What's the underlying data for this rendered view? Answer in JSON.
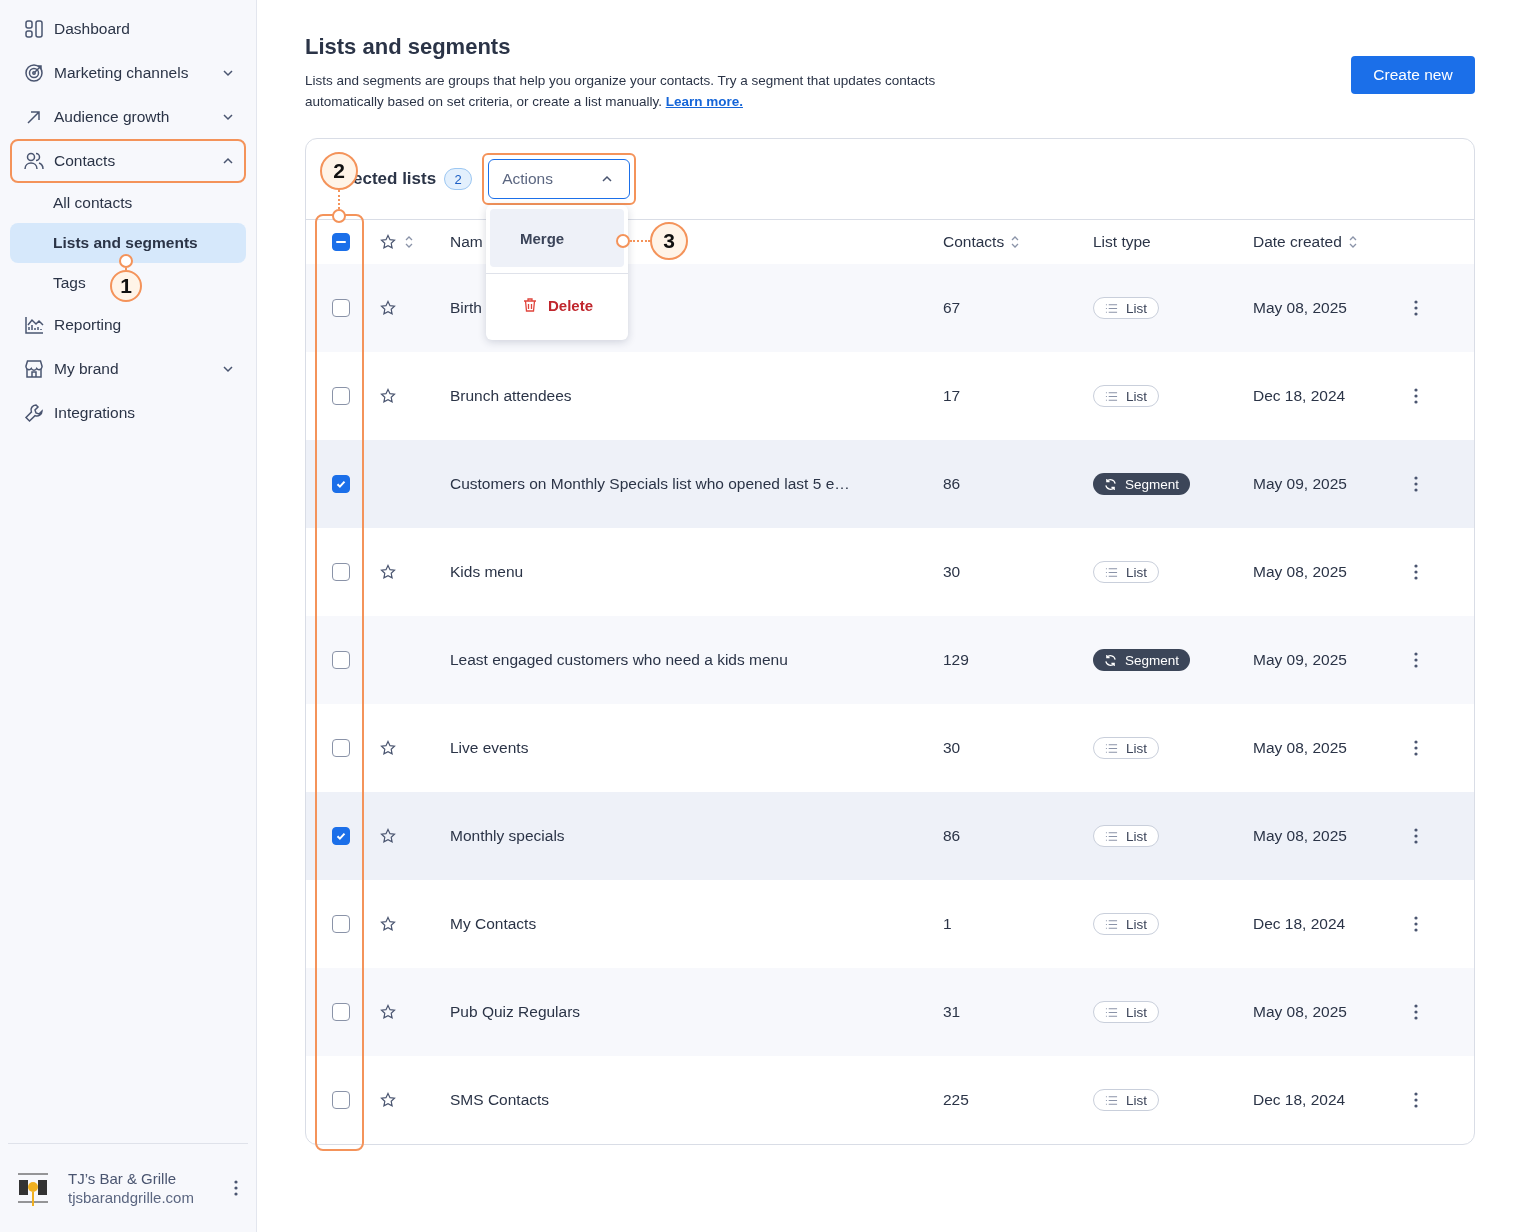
{
  "sidebar": {
    "items": [
      {
        "label": "Dashboard",
        "selected": false,
        "outlined": false
      },
      {
        "label": "Marketing channels",
        "selected": false,
        "outlined": false,
        "expanded": false
      },
      {
        "label": "Audience growth",
        "selected": false,
        "outlined": false,
        "expanded": false
      },
      {
        "label": "Contacts",
        "selected": false,
        "outlined": true,
        "expanded": true,
        "children": [
          {
            "label": "All contacts",
            "selected": false
          },
          {
            "label": "Lists and segments",
            "selected": true
          },
          {
            "label": "Tags",
            "selected": false
          }
        ]
      },
      {
        "label": "Reporting",
        "selected": false,
        "outlined": false
      },
      {
        "label": "My brand",
        "selected": false,
        "outlined": false,
        "expanded": false
      },
      {
        "label": "Integrations",
        "selected": false,
        "outlined": false
      }
    ],
    "account": {
      "name": "TJ’s Bar & Grille",
      "domain": "tjsbarandgrille.com"
    }
  },
  "page": {
    "title": "Lists and segments",
    "description": "Lists and segments are groups that help you organize your contacts. Try a segment that updates contacts automatically based on set criteria, or create a list manually.",
    "link": "Learn more.",
    "create_button": "Create new"
  },
  "table": {
    "selected_label": "ected lists",
    "selected_count": "2",
    "actions": {
      "label": "Actions",
      "expanded": true,
      "outlined": true,
      "menu": [
        {
          "label": "Merge",
          "kind": "merge",
          "selected": true
        },
        {
          "label": "Delete",
          "kind": "delete",
          "selected": false
        }
      ]
    },
    "select_all": {
      "indeterminate": true
    },
    "checkbox_column_outlined": true,
    "columns": [
      {
        "label": "Nam",
        "sortable": false
      },
      {
        "label": "Contacts",
        "sortable": true
      },
      {
        "label": "List type",
        "sortable": false
      },
      {
        "label": "Date created",
        "sortable": true
      }
    ],
    "rows": [
      {
        "name": "Birth",
        "contacts": "67",
        "type": "List",
        "kind": "list",
        "date": "May 08, 2025",
        "checked": false,
        "star_shown": true
      },
      {
        "name": "Brunch attendees",
        "contacts": "17",
        "type": "List",
        "kind": "list",
        "date": "Dec 18, 2024",
        "checked": false,
        "star_shown": true
      },
      {
        "name": "Customers on Monthly Specials list who opened last 5 e…",
        "contacts": "86",
        "type": "Segment",
        "kind": "segment",
        "date": "May 09, 2025",
        "checked": true,
        "star_shown": false
      },
      {
        "name": "Kids menu",
        "contacts": "30",
        "type": "List",
        "kind": "list",
        "date": "May 08, 2025",
        "checked": false,
        "star_shown": true
      },
      {
        "name": "Least engaged customers who need a kids menu",
        "contacts": "129",
        "type": "Segment",
        "kind": "segment",
        "date": "May 09, 2025",
        "checked": false,
        "star_shown": false
      },
      {
        "name": "Live events",
        "contacts": "30",
        "type": "List",
        "kind": "list",
        "date": "May 08, 2025",
        "checked": false,
        "star_shown": true
      },
      {
        "name": "Monthly specials",
        "contacts": "86",
        "type": "List",
        "kind": "list",
        "date": "May 08, 2025",
        "checked": true,
        "star_shown": true
      },
      {
        "name": "My Contacts",
        "contacts": "1",
        "type": "List",
        "kind": "list",
        "date": "Dec 18, 2024",
        "checked": false,
        "star_shown": true
      },
      {
        "name": "Pub Quiz Regulars",
        "contacts": "31",
        "type": "List",
        "kind": "list",
        "date": "May 08, 2025",
        "checked": false,
        "star_shown": true
      },
      {
        "name": "SMS Contacts",
        "contacts": "225",
        "type": "List",
        "kind": "list",
        "date": "Dec 18, 2024",
        "checked": false,
        "star_shown": true
      }
    ]
  },
  "annotations": [
    {
      "label": "1"
    },
    {
      "label": "2"
    },
    {
      "label": "3"
    }
  ]
}
